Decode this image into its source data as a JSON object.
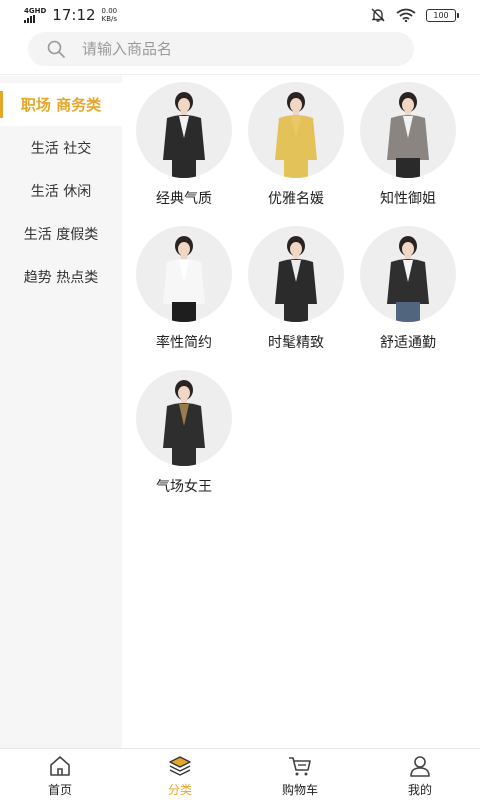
{
  "status": {
    "network": "4GHD",
    "time": "17:12",
    "speed_value": "0.00",
    "speed_unit": "KB/s",
    "battery": "100"
  },
  "search": {
    "placeholder": "请输入商品名"
  },
  "sidebar": {
    "items": [
      {
        "label": "职场 商务类",
        "active": true
      },
      {
        "label": "生活 社交",
        "active": false
      },
      {
        "label": "生活 休闲",
        "active": false
      },
      {
        "label": "生活 度假类",
        "active": false
      },
      {
        "label": "趋势 热点类",
        "active": false
      }
    ]
  },
  "products": [
    {
      "label": "经典气质",
      "icon": "woman-black-suit-icon",
      "top": "#2b2b2b",
      "inner": "#f1f1f1",
      "bottom": "#2a2a2a"
    },
    {
      "label": "优雅名媛",
      "icon": "woman-yellow-dress-icon",
      "top": "#e3c25a",
      "inner": "#e8c867",
      "bottom": "#e3c25a"
    },
    {
      "label": "知性御姐",
      "icon": "woman-plaid-blazer-icon",
      "top": "#8a8580",
      "inner": "#f2f2f2",
      "bottom": "#2a2a2a"
    },
    {
      "label": "率性简约",
      "icon": "woman-white-blouse-icon",
      "top": "#f7f7f7",
      "inner": "#ffffff",
      "bottom": "#1e1e1e"
    },
    {
      "label": "时髦精致",
      "icon": "woman-striped-vest-icon",
      "top": "#2b2b2b",
      "inner": "#ececec",
      "bottom": "#2b2b2b"
    },
    {
      "label": "舒适通勤",
      "icon": "woman-denim-jeans-icon",
      "top": "#2f2f2f",
      "inner": "#f4f4f4",
      "bottom": "#51657e"
    },
    {
      "label": "气场女王",
      "icon": "woman-leopard-coat-icon",
      "top": "#2e2e2e",
      "inner": "#9b7b4c",
      "bottom": "#2e2e2e"
    }
  ],
  "tabbar": {
    "tabs": [
      {
        "label": "首页",
        "icon": "home-icon"
      },
      {
        "label": "分类",
        "icon": "category-icon",
        "active": true
      },
      {
        "label": "购物车",
        "icon": "cart-icon"
      },
      {
        "label": "我的",
        "icon": "profile-icon"
      }
    ]
  },
  "colors": {
    "accent": "#e5a72a"
  }
}
